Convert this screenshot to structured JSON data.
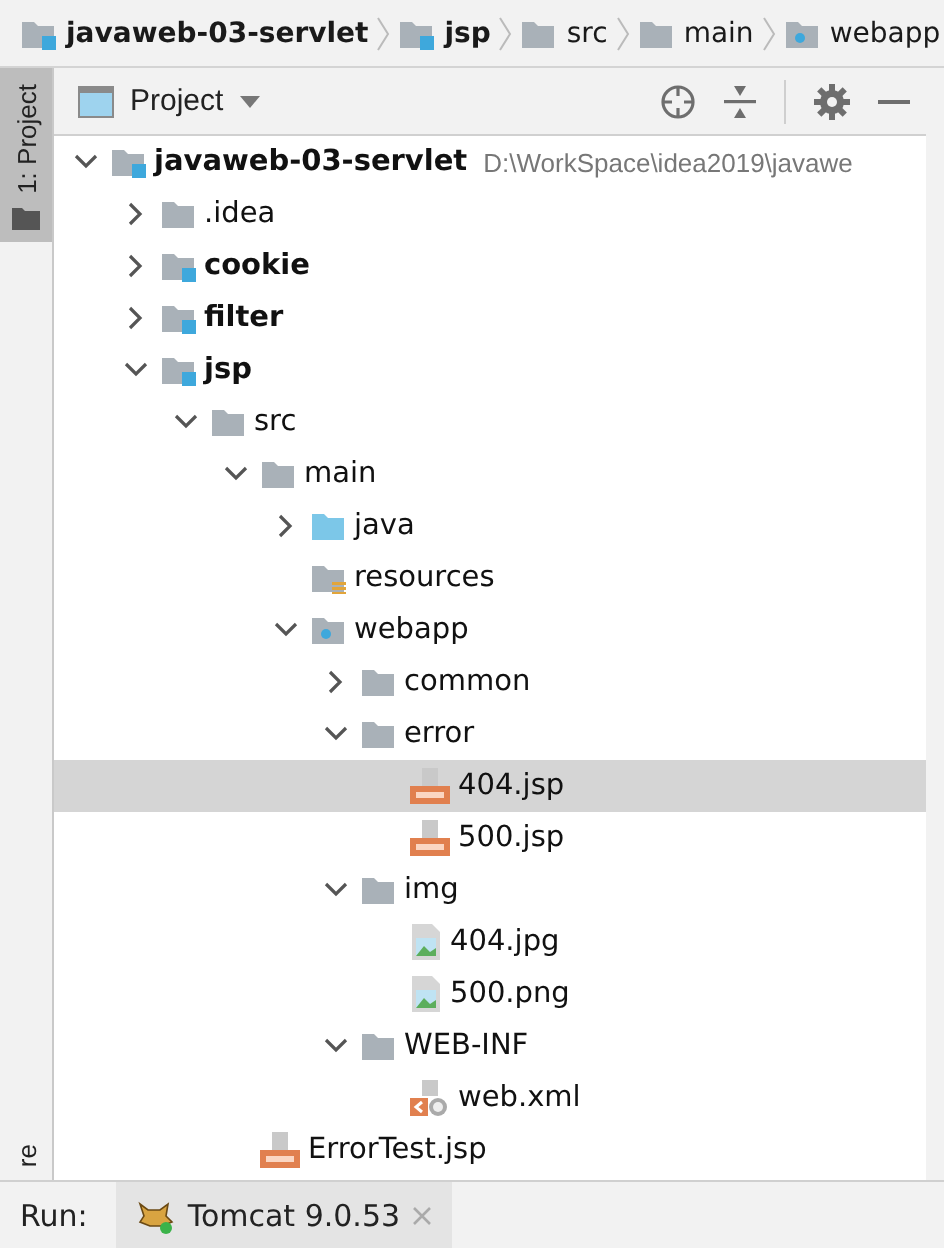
{
  "breadcrumb": [
    {
      "label": "javaweb-03-servlet",
      "kind": "module",
      "bold": true
    },
    {
      "label": "jsp",
      "kind": "module",
      "bold": true
    },
    {
      "label": "src",
      "kind": "folder",
      "bold": false
    },
    {
      "label": "main",
      "kind": "folder",
      "bold": false
    },
    {
      "label": "webapp",
      "kind": "webapp",
      "bold": false
    }
  ],
  "side_tabs": {
    "top": [
      {
        "label": "1: Project",
        "selected": true
      }
    ],
    "bottom": [
      {
        "label": "re",
        "selected": false
      }
    ]
  },
  "panel": {
    "title": "Project"
  },
  "tree": [
    {
      "name": "javaweb-03-servlet",
      "path": "D:\\WorkSpace\\idea2019\\javawe",
      "kind": "module",
      "bold": true,
      "expanded": true,
      "selected": false,
      "children": [
        {
          "name": ".idea",
          "kind": "folder",
          "bold": false,
          "expanded": false,
          "selected": false
        },
        {
          "name": "cookie",
          "kind": "module",
          "bold": true,
          "expanded": false,
          "selected": false
        },
        {
          "name": "filter",
          "kind": "module",
          "bold": true,
          "expanded": false,
          "selected": false
        },
        {
          "name": "jsp",
          "kind": "module",
          "bold": true,
          "expanded": true,
          "selected": false,
          "children": [
            {
              "name": "src",
              "kind": "folder",
              "bold": false,
              "expanded": true,
              "selected": false,
              "children": [
                {
                  "name": "main",
                  "kind": "folder",
                  "bold": false,
                  "expanded": true,
                  "selected": false,
                  "children": [
                    {
                      "name": "java",
                      "kind": "source",
                      "bold": false,
                      "expanded": false,
                      "selected": false
                    },
                    {
                      "name": "resources",
                      "kind": "resources",
                      "bold": false,
                      "selected": false
                    },
                    {
                      "name": "webapp",
                      "kind": "webapp",
                      "bold": false,
                      "expanded": true,
                      "selected": false,
                      "children": [
                        {
                          "name": "common",
                          "kind": "folder",
                          "bold": false,
                          "expanded": false,
                          "selected": false
                        },
                        {
                          "name": "error",
                          "kind": "folder",
                          "bold": false,
                          "expanded": true,
                          "selected": false,
                          "children": [
                            {
                              "name": "404.jsp",
                              "kind": "jsp",
                              "bold": false,
                              "selected": true
                            },
                            {
                              "name": "500.jsp",
                              "kind": "jsp",
                              "bold": false,
                              "selected": false
                            }
                          ]
                        },
                        {
                          "name": "img",
                          "kind": "folder",
                          "bold": false,
                          "expanded": true,
                          "selected": false,
                          "children": [
                            {
                              "name": "404.jpg",
                              "kind": "image",
                              "bold": false,
                              "selected": false
                            },
                            {
                              "name": "500.png",
                              "kind": "image",
                              "bold": false,
                              "selected": false
                            }
                          ]
                        },
                        {
                          "name": "WEB-INF",
                          "kind": "folder",
                          "bold": false,
                          "expanded": true,
                          "selected": false,
                          "children": [
                            {
                              "name": "web.xml",
                              "kind": "xml",
                              "bold": false,
                              "selected": false
                            }
                          ]
                        }
                      ]
                    }
                  ]
                },
                {
                  "name": "ErrorTest.jsp",
                  "kind": "jsp",
                  "bold": false,
                  "selected": false
                }
              ]
            }
          ]
        }
      ]
    }
  ],
  "run_bar": {
    "label": "Run:",
    "tabs": [
      {
        "label": "Tomcat 9.0.53",
        "selected": true
      }
    ]
  }
}
